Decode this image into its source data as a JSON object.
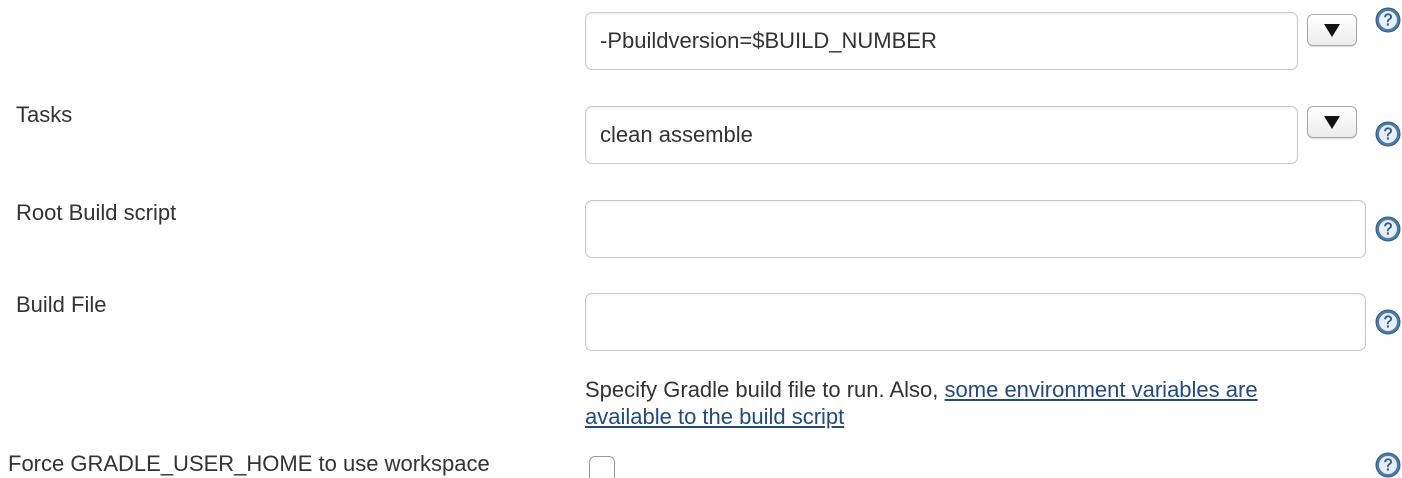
{
  "fields": {
    "switches": {
      "value": "-Pbuildversion=$BUILD_NUMBER"
    },
    "tasks": {
      "label": "Tasks",
      "value": "clean assemble"
    },
    "root_build_script": {
      "label": "Root Build script",
      "value": ""
    },
    "build_file": {
      "label": "Build File",
      "value": "",
      "description_text": "Specify Gradle build file to run. Also, ",
      "description_link": "some environment variables are available to the build script"
    },
    "force_gradle_user_home": {
      "label": "Force GRADLE_USER_HOME to use workspace",
      "checked": false
    }
  },
  "icons": {
    "help": "help-question-icon",
    "dropdown": "triangle-down-icon"
  },
  "colors": {
    "link": "#204a87",
    "help_icon": "#4a7ab0",
    "text": "#333333"
  }
}
